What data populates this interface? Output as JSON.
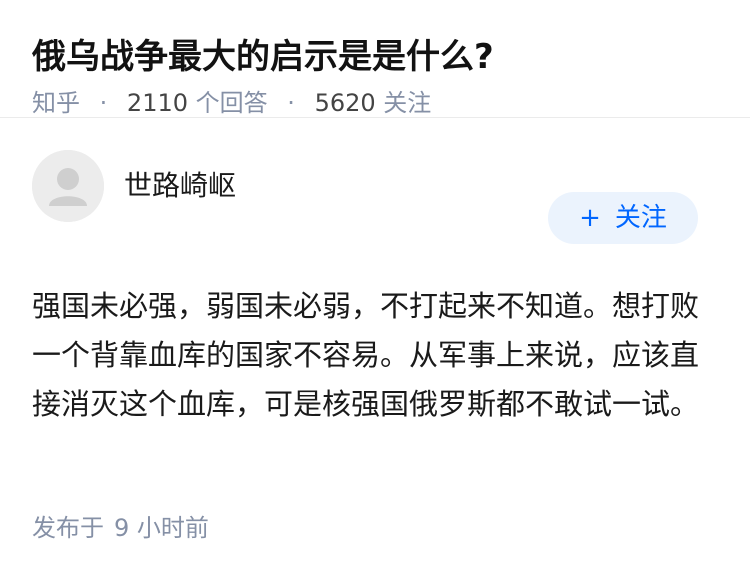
{
  "question": {
    "title": "俄乌战争最大的启示是是什么?",
    "source": "知乎",
    "answer_count": "2110",
    "answer_label": "个回答",
    "follow_count": "5620",
    "follow_label": "关注",
    "separator": "·"
  },
  "answer": {
    "author_name": "世路崎岖",
    "avatar_icon": "default-avatar-icon",
    "follow_button_plus": "+",
    "follow_button_label": "关注",
    "content": "强国未必强，弱国未必弱，不打起来不知道。想打败一个背靠血库的国家不容易。从军事上来说，应该直接消灭这个血库，可是核强国俄罗斯都不敢试一试。",
    "publish_label": "发布于",
    "publish_time": "9 小时前"
  },
  "colors": {
    "accent": "#0066ff",
    "button_bg": "#ebf3fd",
    "meta_text": "#8590a6",
    "avatar_bg": "#ececec"
  }
}
